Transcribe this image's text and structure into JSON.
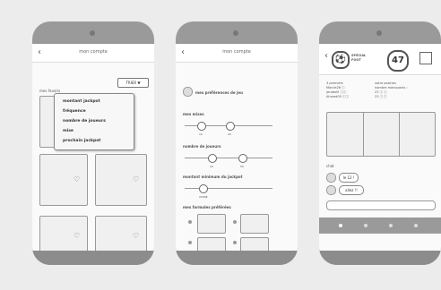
{
  "phone1": {
    "title": "mon compte",
    "sort_button": "TRIER ▼",
    "section_label": "mes favoris",
    "dropdown": [
      "montant jackpot",
      "fréquence",
      "nombre de joueurs",
      "mise",
      "prochain jackpot"
    ]
  },
  "phone2": {
    "title": "mon compte",
    "preferences_label": "mes préférences de jeu",
    "bets_label": "mes mises",
    "bets_values": [
      "10",
      "20"
    ],
    "players_label": "nombre de joueurs",
    "players_values": [
      "10",
      "50"
    ],
    "jackpot_label": "montant minimum du jackpot",
    "jackpot_value": "2000€",
    "formulas_label": "mes formules préférées"
  },
  "phone3": {
    "badge_label": "SPÉCIAL FOOT",
    "counter": "47",
    "left_col": [
      "3 premiers",
      "Marcie26 ⓘ",
      "jerabel0 ⓘⓘ",
      "Ahmed09 ⓘⓘ"
    ],
    "right_col": [
      "votre position",
      "nombre manquants :",
      "23 ⓘ ⓘ",
      "23 ⓘ ⓘ"
    ],
    "chat_label": "chat",
    "chat_msgs": [
      "le 12 !",
      "allez !!"
    ]
  }
}
